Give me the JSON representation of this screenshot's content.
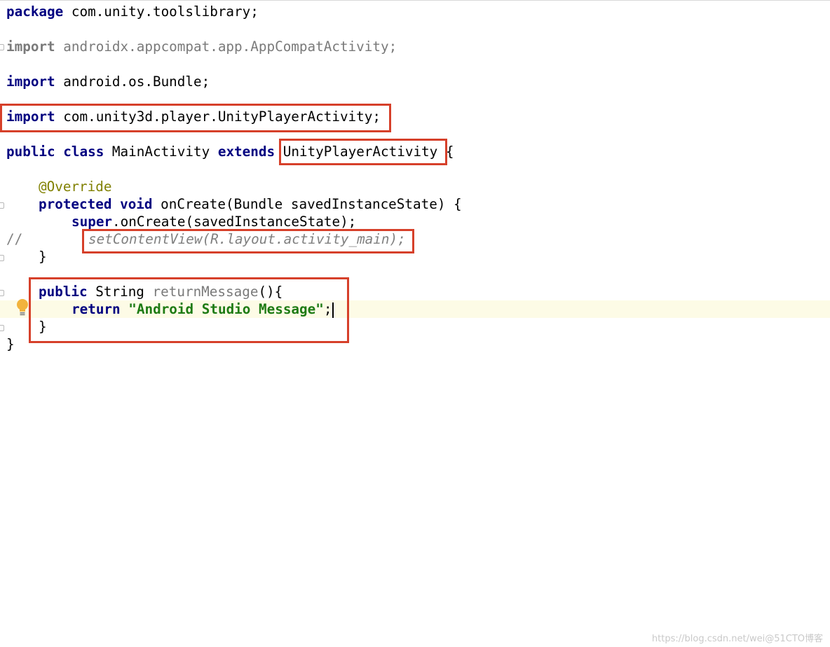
{
  "code": {
    "l1": {
      "kw": "package",
      "rest": " com.unity.toolslibrary;"
    },
    "l2": {
      "kw": "import",
      "rest": " androidx.appcompat.app.AppCompatActivity;"
    },
    "l3": {
      "kw": "import",
      "rest": " android.os.Bundle;"
    },
    "l4": {
      "kw": "import",
      "rest": " com.unity3d.player.UnityPlayerActivity;"
    },
    "l5": {
      "kw1": "public",
      "kw2": "class",
      "name": " MainActivity ",
      "kw3": "extends",
      "parent": " UnityPlayerActivity ",
      "brace": "{"
    },
    "l6": {
      "annotation": "@Override"
    },
    "l7": {
      "kw1": "protected",
      "kw2": "void",
      "rest": " onCreate(Bundle savedInstanceState) {"
    },
    "l8": {
      "kw": "super",
      "rest": ".onCreate(savedInstanceState);"
    },
    "l9": {
      "comment": "//",
      "call": "setContentView(R.layout.activity_main);"
    },
    "l10": {
      "brace": "}"
    },
    "l11": {
      "kw": "public",
      "type": " String ",
      "method": "returnMessage",
      "rest": "(){"
    },
    "l12": {
      "kw": "return",
      "string": "\"Android Studio Message\"",
      "end": ";"
    },
    "l13": {
      "brace": "}"
    },
    "l14": {
      "brace": "}"
    }
  },
  "highlight_color": "#d6402a",
  "caret_line_color": "#fdfbe6",
  "icons": {
    "intention": "lightbulb-icon",
    "fold": "fold-marker-icon"
  },
  "watermark": "https://blog.csdn.net/wei@51CTO博客"
}
